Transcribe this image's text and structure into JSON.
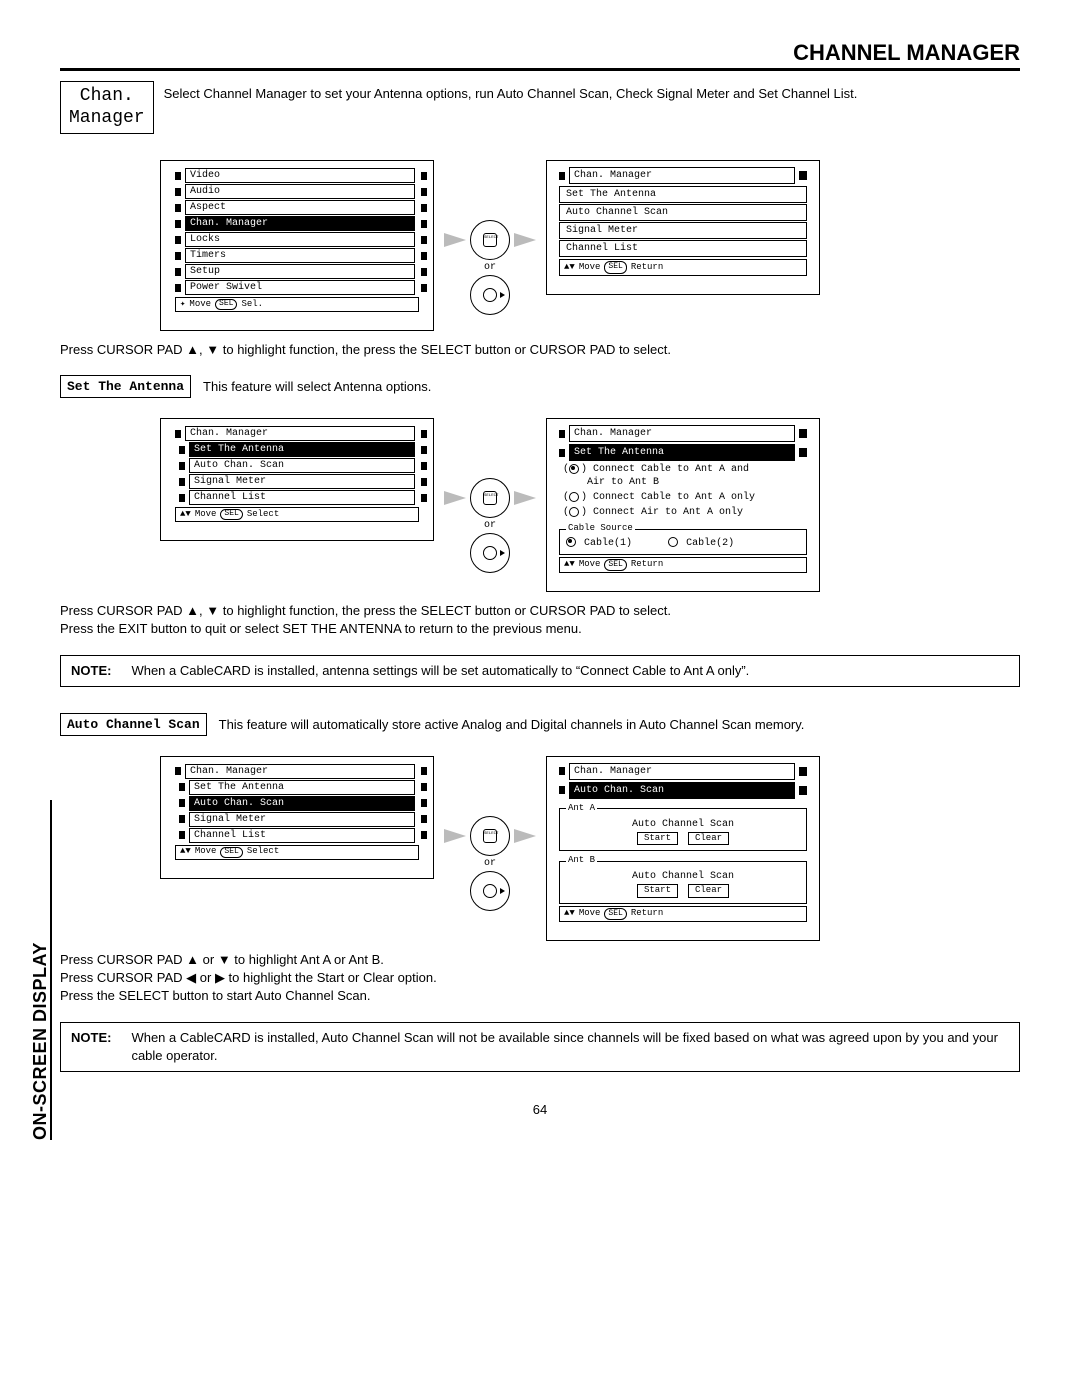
{
  "page_title": "CHANNEL MANAGER",
  "side_label": "ON-SCREEN DISPLAY",
  "page_number": "64",
  "chan_box": {
    "line1": "Chan.",
    "line2": "Manager"
  },
  "intro_text": "Select Channel Manager to set your Antenna options, run Auto Channel Scan, Check Signal Meter and Set Channel List.",
  "connector_or": "or",
  "menu1_items": [
    "Video",
    "Audio",
    "Aspect",
    "Chan. Manager",
    "Locks",
    "Timers",
    "Setup",
    "Power Swivel"
  ],
  "menu1_highlight_index": 3,
  "menu1_foot_move": "Move",
  "menu1_foot_sel_pill": "SEL",
  "menu1_foot_sel": "Sel.",
  "sub1_header": "Chan. Manager",
  "sub1_items": [
    "Set The Antenna",
    "Auto Channel Scan",
    "Signal Meter",
    "Channel List"
  ],
  "sub1_foot_move": "Move",
  "sub1_foot_sel_pill": "SEL",
  "sub1_foot_return": "Return",
  "text_after1": "Press CURSOR PAD ▲, ▼ to highlight function, the press the SELECT button or CURSOR PAD to select.",
  "feature1_label": "Set The Antenna",
  "feature1_desc": "This feature will select Antenna options.",
  "menu2_header": "Chan. Manager",
  "menu2_items": [
    "Set The Antenna",
    "Auto Chan. Scan",
    "Signal Meter",
    "Channel List"
  ],
  "menu2_highlight_index": 0,
  "menu2_foot_move": "Move",
  "menu2_foot_sel_pill": "SEL",
  "menu2_foot_select": "Select",
  "sub2_header": "Chan. Manager",
  "sub2_highlight": "Set The Antenna",
  "sub2_opt1_line1": "Connect Cable to Ant A and",
  "sub2_opt1_line2": "Air to Ant B",
  "sub2_opt2": "Connect Cable to Ant A only",
  "sub2_opt3": "Connect Air to Ant A only",
  "sub2_cable_legend": "Cable Source",
  "sub2_cable1": "Cable(1)",
  "sub2_cable2": "Cable(2)",
  "sub2_foot_move": "Move",
  "sub2_foot_sel_pill": "SEL",
  "sub2_foot_return": "Return",
  "text_after2_l1": "Press CURSOR PAD ▲, ▼ to highlight function, the press the SELECT button or CURSOR PAD to select.",
  "text_after2_l2": "Press the EXIT button to quit or select SET THE ANTENNA to return to the previous menu.",
  "note1_label": "NOTE:",
  "note1_text": "When a CableCARD is installed, antenna settings will be set automatically to “Connect Cable to Ant A only”.",
  "feature2_label": "Auto Channel Scan",
  "feature2_desc": "This feature will automatically store active Analog and Digital channels in Auto Channel Scan memory.",
  "menu3_header": "Chan. Manager",
  "menu3_items": [
    "Set The Antenna",
    "Auto Chan. Scan",
    "Signal Meter",
    "Channel List"
  ],
  "menu3_highlight_index": 1,
  "menu3_foot_move": "Move",
  "menu3_foot_sel_pill": "SEL",
  "menu3_foot_select": "Select",
  "sub3_header": "Chan. Manager",
  "sub3_highlight": "Auto Chan. Scan",
  "sub3_antA_legend": "Ant A",
  "sub3_antB_legend": "Ant B",
  "sub3_acs_label": "Auto Channel Scan",
  "sub3_start": "Start",
  "sub3_clear": "Clear",
  "sub3_foot_move": "Move",
  "sub3_foot_sel_pill": "SEL",
  "sub3_foot_return": "Return",
  "text_after3_l1": "Press CURSOR PAD ▲ or ▼ to highlight Ant A or Ant B.",
  "text_after3_l2": "Press CURSOR PAD ◀ or ▶ to highlight the Start or Clear option.",
  "text_after3_l3": "Press the SELECT button to start Auto Channel Scan.",
  "note2_label": "NOTE:",
  "note2_text": "When a CableCARD is installed, Auto Channel Scan will not be available since channels will be fixed based on what was agreed upon by you and your cable operator."
}
